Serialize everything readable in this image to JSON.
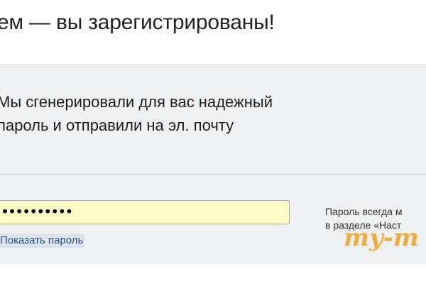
{
  "header": {
    "title": "ем — вы зарегистрированы!"
  },
  "panel": {
    "info_lines": [
      "Мы сгенерировали для вас надежный",
      "пароль и отправили на эл. почту"
    ],
    "password_field": {
      "value": "••••••••••"
    },
    "show_password_link": "Показать пароль",
    "hint_lines": [
      "Пароль всегда м",
      "в разделе «Наст"
    ]
  },
  "watermark": {
    "text": "my-m"
  },
  "colors": {
    "panel_background": "#eff0f2",
    "password_background": "#fdfcc6",
    "link": "#2d4f8a",
    "watermark": "#f0a11e"
  }
}
